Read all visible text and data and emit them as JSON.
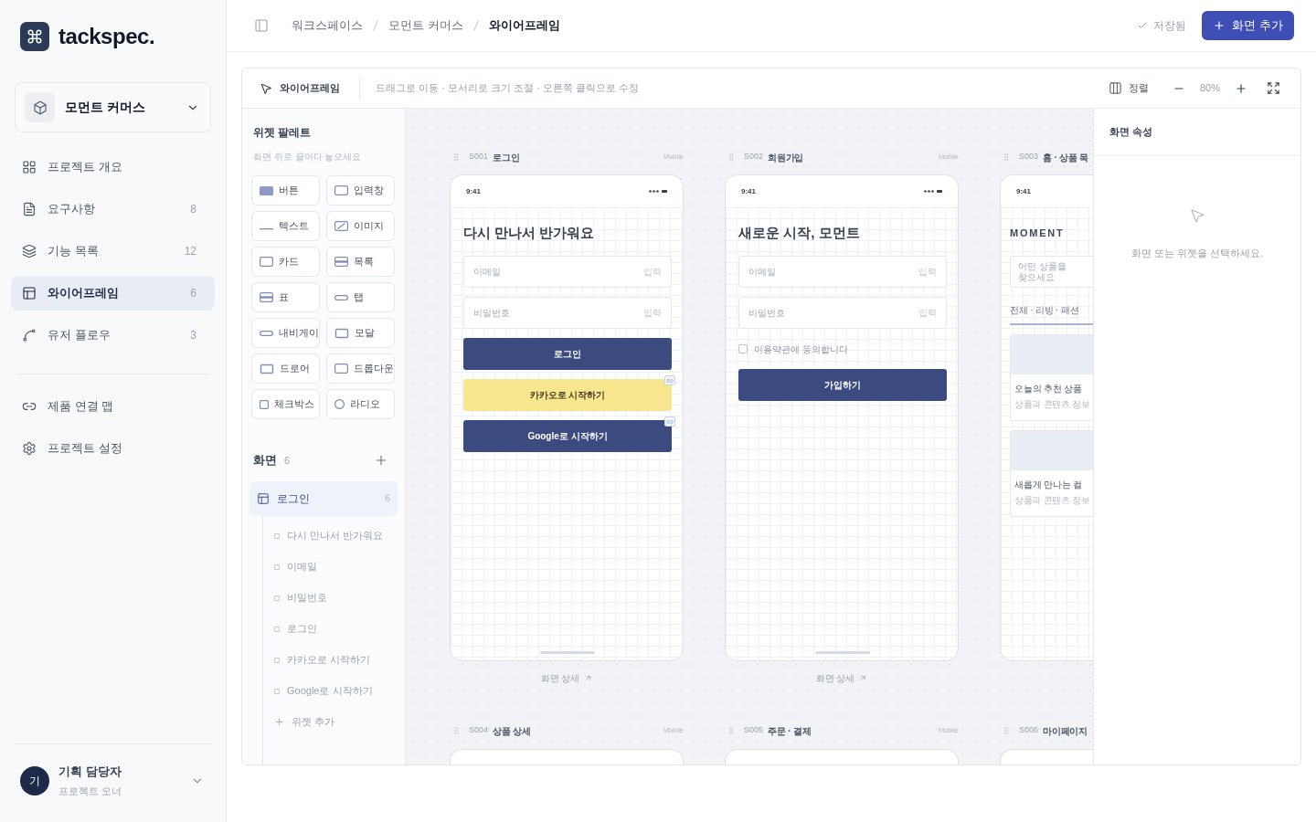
{
  "sidebar": {
    "brand": "tackspec.",
    "project": {
      "name": "모먼트 커머스"
    },
    "nav": [
      {
        "kind": "overview",
        "label": "프로젝트 개요",
        "selected": false
      },
      {
        "kind": "requirements",
        "label": "요구사항",
        "count": "8",
        "selected": false
      },
      {
        "kind": "features",
        "label": "기능 목록",
        "count": "12",
        "selected": false
      },
      {
        "kind": "wireframe",
        "label": "와이어프레임",
        "count": "6",
        "selected": true
      },
      {
        "kind": "flow",
        "label": "유저 플로우",
        "count": "3",
        "selected": false
      }
    ],
    "nav_secondary": [
      {
        "kind": "map",
        "label": "제품 연결 맵",
        "selected": false
      },
      {
        "kind": "settings",
        "label": "프로젝트 설정",
        "selected": false
      }
    ],
    "user": {
      "initial": "기",
      "name": "기획 담당자",
      "role": "프로젝트 오너"
    }
  },
  "header": {
    "breadcrumb": [
      {
        "label": "워크스페이스",
        "current": false
      },
      {
        "label": "모먼트 커머스",
        "current": false
      },
      {
        "label": "와이어프레임",
        "current": true
      }
    ],
    "save_status": "저장됨",
    "add_button": "화면 추가"
  },
  "toolbar": {
    "mode": "와이어프레임",
    "hint": "드래그로 이동 · 모서리로 크기 조절 · 오른쪽 클릭으로 수정",
    "align": "정렬",
    "zoom": "80%"
  },
  "palette": {
    "title": "위젯 팔레트",
    "hint": "화면 위로 끌어다 놓으세요",
    "widgets": [
      {
        "kind": "button",
        "label": "버튼"
      },
      {
        "kind": "input",
        "label": "입력창"
      },
      {
        "kind": "text",
        "label": "텍스트"
      },
      {
        "kind": "image",
        "label": "이미지"
      },
      {
        "kind": "card",
        "label": "카드"
      },
      {
        "kind": "list",
        "label": "목록"
      },
      {
        "kind": "table",
        "label": "표"
      },
      {
        "kind": "tab",
        "label": "탭"
      },
      {
        "kind": "navigation",
        "label": "내비게이"
      },
      {
        "kind": "modal",
        "label": "모달"
      },
      {
        "kind": "drawer",
        "label": "드로어"
      },
      {
        "kind": "dropdown",
        "label": "드롭다운"
      },
      {
        "kind": "checkbox",
        "label": "체크박스"
      },
      {
        "kind": "radio",
        "label": "라디오"
      }
    ]
  },
  "screen_list": {
    "title": "화면",
    "count": "6",
    "items": [
      {
        "label": "로그인",
        "count": "6",
        "selected": true,
        "expanded": true,
        "children": [
          {
            "label": "다시 만나서 반가워요"
          },
          {
            "label": "이메일"
          },
          {
            "label": "비밀번호"
          },
          {
            "label": "로그인"
          },
          {
            "label": "카카오로 시작하기"
          },
          {
            "label": "Google로 시작하기"
          }
        ],
        "add_widget": "위젯 추가"
      }
    ]
  },
  "canvas": {
    "screens": [
      {
        "code": "S001",
        "name": "로그인",
        "device": "Mobile",
        "time": "9:41",
        "widgets": [
          {
            "kind": "title",
            "text": "다시 만나서 반가워요"
          },
          {
            "kind": "input",
            "placeholder": "이메일",
            "type_label": "입력"
          },
          {
            "kind": "input",
            "placeholder": "비밀번호",
            "type_label": "입력"
          },
          {
            "kind": "button",
            "color": "#3b4b7f",
            "label": "로그인",
            "linked": false
          },
          {
            "kind": "button",
            "color": "#f7e68e",
            "label": "카카오로 시작하기",
            "linked": true
          },
          {
            "kind": "button",
            "color": "#3b4b7f",
            "label": "Google로 시작하기",
            "linked": true
          }
        ],
        "detail_link": "화면 상세"
      },
      {
        "code": "S002",
        "name": "회원가입",
        "device": "Mobile",
        "time": "9:41",
        "widgets": [
          {
            "kind": "title",
            "text": "새로운 시작, 모먼트"
          },
          {
            "kind": "input",
            "placeholder": "이메일",
            "type_label": "입력"
          },
          {
            "kind": "input",
            "placeholder": "비밀번호",
            "type_label": "입력"
          },
          {
            "kind": "checkbox",
            "label": "이용약관에 동의합니다",
            "checked": false
          },
          {
            "kind": "button",
            "color": "#3b4b7f",
            "label": "가입하기",
            "linked": false
          }
        ],
        "detail_link": "화면 상세"
      },
      {
        "code": "S003",
        "name": "홈 · 상품 목",
        "time": "9:41",
        "widgets": [
          {
            "kind": "logo",
            "text": "MOMENT"
          },
          {
            "kind": "search",
            "placeholder": "어떤 상품을 찾으세요"
          },
          {
            "kind": "tabs",
            "text": "전체 · 리빙 · 패션"
          },
          {
            "kind": "card",
            "title": "오늘의 추천 상품",
            "subtitle": "상품과 콘텐츠 정보"
          },
          {
            "kind": "card",
            "title": "새롭게 만나는 컬",
            "subtitle": "상품과 콘텐츠 정보"
          }
        ]
      },
      {
        "code": "S004",
        "name": "상품 상세",
        "device": "Mobile"
      },
      {
        "code": "S005",
        "name": "주문 · 결제",
        "device": "Mobile"
      },
      {
        "code": "S006",
        "name": "마이페이지"
      }
    ]
  },
  "inspector": {
    "title": "화면 속성",
    "empty_message": "화면 또는 위젯을 선택하세요."
  }
}
